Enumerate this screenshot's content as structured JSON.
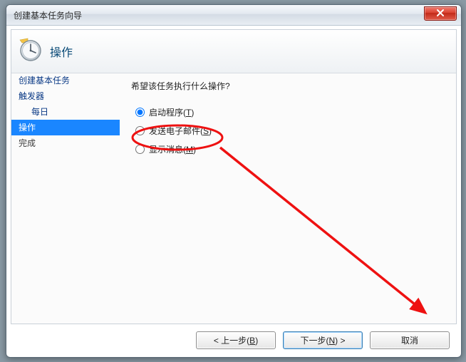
{
  "window": {
    "title": "创建基本任务向导"
  },
  "header": {
    "title": "操作"
  },
  "sidebar": {
    "items": [
      {
        "label": "创建基本任务"
      },
      {
        "label": "触发器"
      },
      {
        "label": "每日"
      },
      {
        "label": "操作",
        "active": true
      },
      {
        "label": "完成"
      }
    ]
  },
  "content": {
    "prompt": "希望该任务执行什么操作?",
    "options": [
      {
        "label": "启动程序",
        "key": "T",
        "selected": true
      },
      {
        "label": "发送电子邮件",
        "key": "S",
        "selected": false
      },
      {
        "label": "显示消息",
        "key": "M",
        "selected": false
      }
    ]
  },
  "footer": {
    "back": {
      "label": "上一步",
      "key": "B"
    },
    "next": {
      "label": "下一步",
      "key": "N"
    },
    "cancel": {
      "label": "取消"
    }
  },
  "annotation": {
    "color": "#ee1111"
  }
}
